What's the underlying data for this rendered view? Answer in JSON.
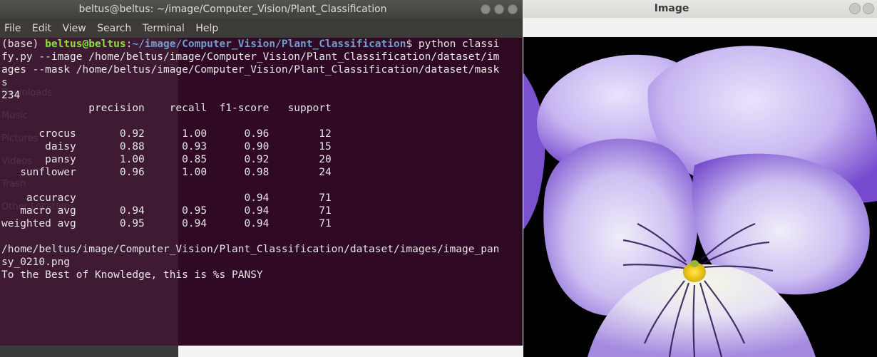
{
  "terminal": {
    "title": "beltus@beltus: ~/image/Computer_Vision/Plant_Classification",
    "menu": [
      "File",
      "Edit",
      "View",
      "Search",
      "Terminal",
      "Help"
    ],
    "prompt_prefix": "(base) ",
    "prompt_user": "beltus@beltus",
    "prompt_colon": ":",
    "prompt_path": "~/image/Computer_Vision/Plant_Classification",
    "prompt_dollar": "$ ",
    "command_first": "python classi",
    "lines": [
      "fy.py --image /home/beltus/image/Computer_Vision/Plant_Classification/dataset/im",
      "ages --mask /home/beltus/image/Computer_Vision/Plant_Classification/dataset/mask",
      "s",
      "234",
      "              precision    recall  f1-score   support",
      "",
      "      crocus       0.92      1.00      0.96        12",
      "       daisy       0.88      0.93      0.90        15",
      "       pansy       1.00      0.85      0.92        20",
      "   sunflower       0.96      1.00      0.98        24",
      "",
      "    accuracy                           0.94        71",
      "   macro avg       0.94      0.95      0.94        71",
      "weighted avg       0.95      0.94      0.94        71",
      "",
      "/home/beltus/image/Computer_Vision/Plant_Classification/dataset/images/image_pan",
      "sy_0210.png",
      "To the Best of Knowledge, this is %s PANSY"
    ],
    "ghost_sidebar": [
      "Downloads",
      "Music",
      "Pictures",
      "Videos",
      "Trash",
      "Other Locations"
    ]
  },
  "image_window": {
    "title": "Image"
  },
  "colors": {
    "terminal_bg": "#300a24",
    "prompt_user": "#8ae234",
    "prompt_path": "#729fcf",
    "petal_light": "#ece6fb",
    "petal_dark": "#6a3ec8",
    "flower_center": "#f4d21a"
  }
}
